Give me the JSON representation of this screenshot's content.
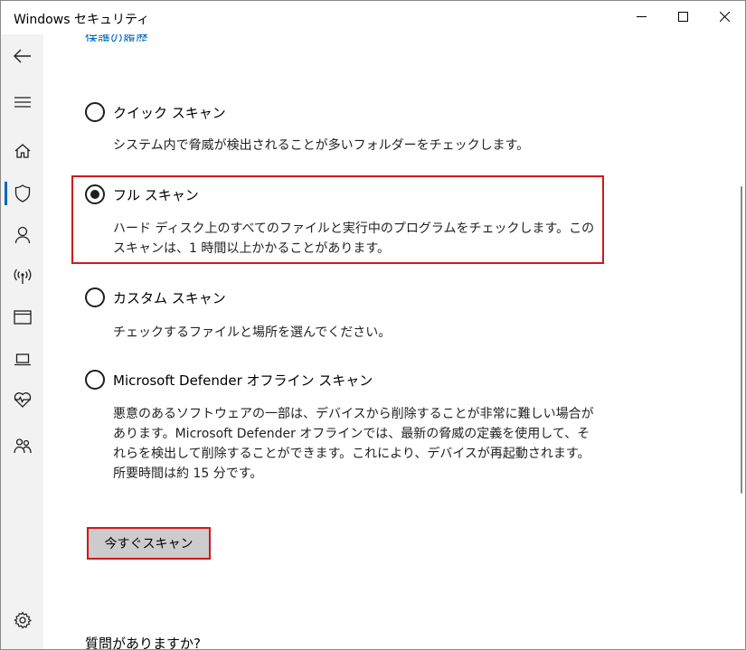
{
  "window": {
    "title": "Windows セキュリティ",
    "controls": {
      "minimize": "minimize-icon",
      "maximize": "maximize-icon",
      "close": "close-icon"
    }
  },
  "nav": {
    "items": [
      {
        "name": "back",
        "icon": "back-arrow-icon"
      },
      {
        "name": "menu",
        "icon": "hamburger-icon"
      },
      {
        "name": "home",
        "icon": "home-icon"
      },
      {
        "name": "virus-protection",
        "icon": "shield-icon",
        "active": true
      },
      {
        "name": "account-protection",
        "icon": "person-icon"
      },
      {
        "name": "firewall",
        "icon": "antenna-icon"
      },
      {
        "name": "app-browser-control",
        "icon": "browser-window-icon"
      },
      {
        "name": "device-security",
        "icon": "laptop-icon"
      },
      {
        "name": "device-performance",
        "icon": "heart-pulse-icon"
      },
      {
        "name": "family-options",
        "icon": "family-icon"
      },
      {
        "name": "settings",
        "icon": "gear-icon"
      }
    ],
    "accent_color": "#0067c0"
  },
  "content": {
    "history_link": "保護の履歴",
    "options": [
      {
        "label": "クイック スキャン",
        "description": "システム内で脅威が検出されることが多いフォルダーをチェックします。",
        "selected": false
      },
      {
        "label": "フル スキャン",
        "description": "ハード ディスク上のすべてのファイルと実行中のプログラムをチェックします。このスキャンは、1 時間以上かかることがあります。",
        "selected": true
      },
      {
        "label": "カスタム スキャン",
        "description": "チェックするファイルと場所を選んでください。",
        "selected": false
      },
      {
        "label": "Microsoft Defender オフライン スキャン",
        "description": "悪意のあるソフトウェアの一部は、デバイスから削除することが非常に難しい場合があります。Microsoft Defender オフラインでは、最新の脅威の定義を使用して、それらを検出して削除することができます。これにより、デバイスが再起動されます。所要時間は約 15 分です。",
        "selected": false
      }
    ],
    "scan_button": "今すぐスキャン",
    "question_heading": "質問がありますか?",
    "highlight_color": "#d0181c"
  }
}
